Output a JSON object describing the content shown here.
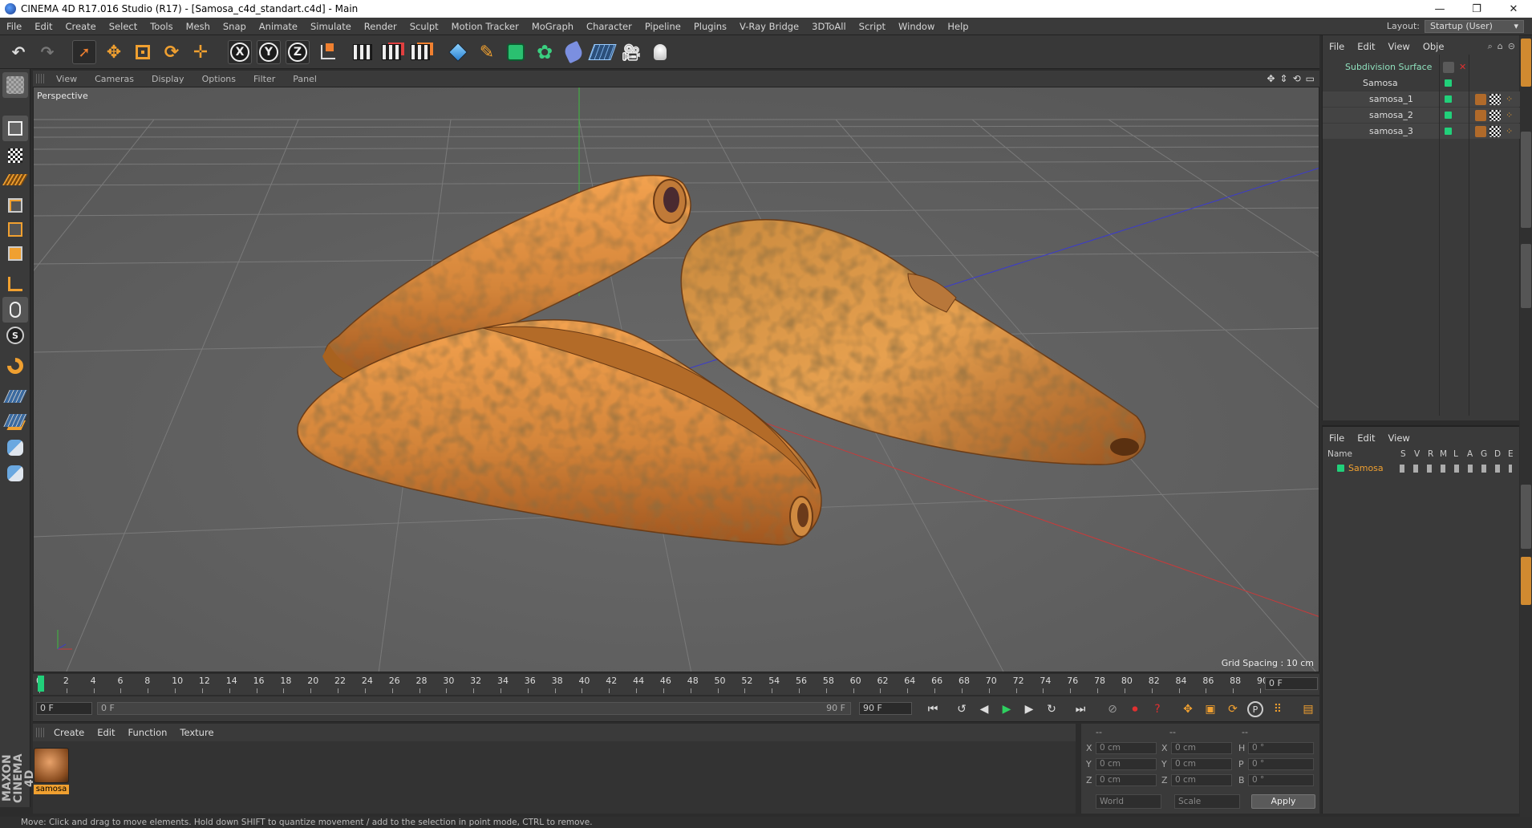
{
  "window": {
    "title": "CINEMA 4D R17.016 Studio (R17) - [Samosa_c4d_standart.c4d] - Main",
    "controls": [
      "—",
      "❐",
      "✕"
    ]
  },
  "menu": [
    "File",
    "Edit",
    "Create",
    "Select",
    "Tools",
    "Mesh",
    "Snap",
    "Animate",
    "Simulate",
    "Render",
    "Sculpt",
    "Motion Tracker",
    "MoGraph",
    "Character",
    "Pipeline",
    "Plugins",
    "V-Ray Bridge",
    "3DToAll",
    "Script",
    "Window",
    "Help"
  ],
  "layout": {
    "label": "Layout:",
    "value": "Startup (User)"
  },
  "toolbar": {
    "x_label": "X",
    "y_label": "Y",
    "z_label": "Z"
  },
  "viewport": {
    "menu": [
      "View",
      "Cameras",
      "Display",
      "Options",
      "Filter",
      "Panel"
    ],
    "label": "Perspective",
    "grid_spacing": "Grid Spacing : 10 cm"
  },
  "timeline": {
    "frames": [
      "0",
      "2",
      "4",
      "6",
      "8",
      "10",
      "12",
      "14",
      "16",
      "18",
      "20",
      "22",
      "24",
      "26",
      "28",
      "30",
      "32",
      "34",
      "36",
      "38",
      "40",
      "42",
      "44",
      "46",
      "48",
      "50",
      "52",
      "54",
      "56",
      "58",
      "60",
      "62",
      "64",
      "66",
      "68",
      "70",
      "72",
      "74",
      "76",
      "78",
      "80",
      "82",
      "84",
      "86",
      "88",
      "90"
    ],
    "end_field": "0 F",
    "current_frame": "0 F",
    "range_start": "0 F",
    "range_end": "90 F",
    "max_frame": "90 F"
  },
  "material_manager": {
    "menu": [
      "Create",
      "Edit",
      "Function",
      "Texture"
    ],
    "material_name": "samosa"
  },
  "coordinates": {
    "header": [
      "--",
      "--",
      "--"
    ],
    "rows": [
      {
        "a": "X",
        "a_val": "0 cm",
        "b": "X",
        "b_val": "0 cm",
        "c": "H",
        "c_val": "0 °"
      },
      {
        "a": "Y",
        "a_val": "0 cm",
        "b": "Y",
        "b_val": "0 cm",
        "c": "P",
        "c_val": "0 °"
      },
      {
        "a": "Z",
        "a_val": "0 cm",
        "b": "Z",
        "b_val": "0 cm",
        "c": "B",
        "c_val": "0 °"
      }
    ],
    "space": "World",
    "mode": "Scale",
    "apply": "Apply"
  },
  "object_manager": {
    "menu": [
      "File",
      "Edit",
      "View",
      "Obje"
    ],
    "objects": [
      {
        "name": "Subdivision Surface",
        "color": "#5fd0a0"
      },
      {
        "name": "Samosa",
        "color": "#dddddd"
      },
      {
        "name": "samosa_1",
        "color": "#dddddd"
      },
      {
        "name": "samosa_2",
        "color": "#dddddd"
      },
      {
        "name": "samosa_3",
        "color": "#dddddd"
      }
    ]
  },
  "layer_manager": {
    "menu": [
      "File",
      "Edit",
      "View"
    ],
    "columns": [
      "Name",
      "S",
      "V",
      "R",
      "M",
      "L",
      "A",
      "G",
      "D",
      "E"
    ],
    "layers": [
      {
        "name": "Samosa",
        "color": "#f0a030"
      }
    ]
  },
  "status": "Move: Click and drag to move elements. Hold down SHIFT to quantize movement / add to the selection in point mode, CTRL to remove.",
  "maxon": "MAXON CINEMA 4D",
  "colors": {
    "accent": "#21d07a",
    "orange": "#f0a030",
    "viewport": "#5c5c5c"
  }
}
